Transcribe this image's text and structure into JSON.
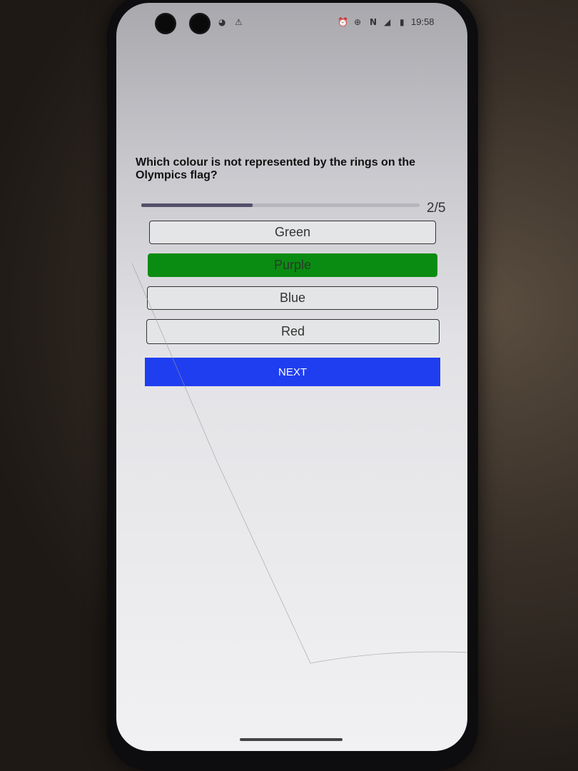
{
  "status_bar": {
    "time": "19:58",
    "left_icons": [
      "notification-circle-icon",
      "warning-icon"
    ],
    "right_icons": [
      "alarm-icon",
      "data-saver-icon",
      "nfc-icon",
      "signal-icon",
      "battery-icon"
    ]
  },
  "quiz": {
    "question": "Which colour is not represented by the rings on the Olympics flag?",
    "progress_text": "2/5",
    "progress_fraction": 0.4,
    "options": [
      {
        "label": "Green",
        "selected": false
      },
      {
        "label": "Purple",
        "selected": true
      },
      {
        "label": "Blue",
        "selected": false
      },
      {
        "label": "Red",
        "selected": false
      }
    ],
    "next_label": "NEXT"
  },
  "colors": {
    "selected_option": "#0a8c12",
    "next_button": "#1f3ef0",
    "progress_fill": "#54506a"
  }
}
